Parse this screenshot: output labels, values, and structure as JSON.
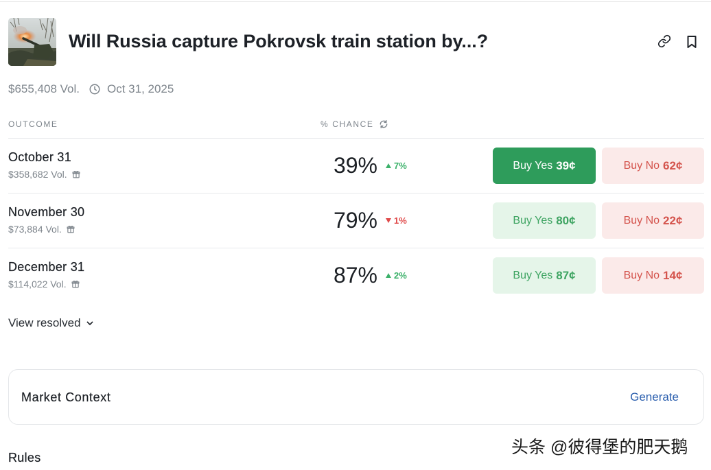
{
  "market": {
    "title": "Will Russia capture Pokrovsk train station by...?",
    "volume": "$655,408 Vol.",
    "end_date": "Oct 31, 2025"
  },
  "table": {
    "columns": [
      "OUTCOME",
      "% CHANCE"
    ],
    "rows": [
      {
        "label": "October 31",
        "volume": "$358,682 Vol.",
        "chance": "39%",
        "change": "7%",
        "change_up": true,
        "yes_label": "Buy Yes",
        "yes_price": "39¢",
        "no_label": "Buy No",
        "no_price": "62¢",
        "yes_selected": true
      },
      {
        "label": "November 30",
        "volume": "$73,884 Vol.",
        "chance": "79%",
        "change": "1%",
        "change_up": false,
        "yes_label": "Buy Yes",
        "yes_price": "80¢",
        "no_label": "Buy No",
        "no_price": "22¢",
        "yes_selected": false
      },
      {
        "label": "December 31",
        "volume": "$114,022 Vol.",
        "chance": "87%",
        "change": "2%",
        "change_up": true,
        "yes_label": "Buy Yes",
        "yes_price": "87¢",
        "no_label": "Buy No",
        "no_price": "14¢",
        "yes_selected": false
      }
    ]
  },
  "view_resolved": "View resolved",
  "market_context": {
    "title": "Market Context",
    "action": "Generate"
  },
  "rules": {
    "title": "Rules"
  },
  "watermark": "头条 @彼得堡的肥天鹅",
  "icons": {
    "link": "link-icon",
    "bookmark": "bookmark-icon",
    "clock": "clock-icon",
    "refresh": "refresh-icon",
    "gift": "gift-icon",
    "chevron": "chevron-down-icon"
  },
  "colors": {
    "yes_solid": "#2e9c5b",
    "yes_bg": "#e5f5e9",
    "yes_text": "#3ea462",
    "no_bg": "#fbeae9",
    "no_text": "#d4534c",
    "change_up": "#3cb16a",
    "change_down": "#e04a4a",
    "link": "#2b5fae"
  }
}
